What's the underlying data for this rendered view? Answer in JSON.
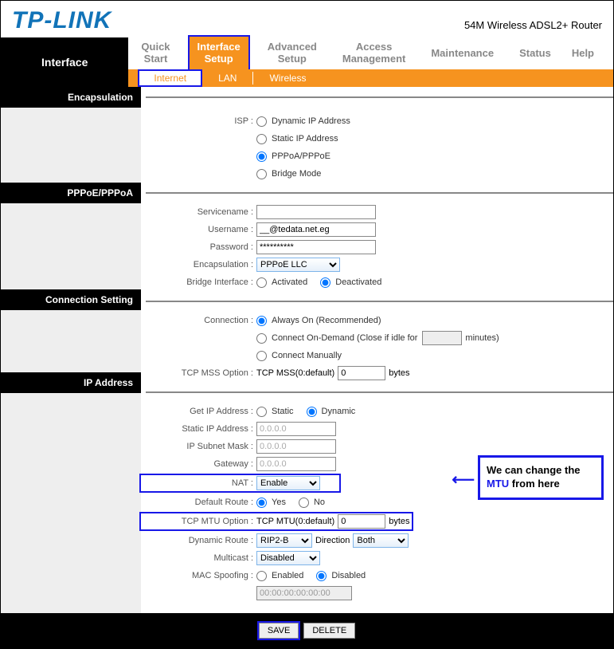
{
  "header": {
    "brand_a": "TP",
    "brand_b": "-LINK",
    "product": "54M Wireless ADSL2+ Router"
  },
  "nav": {
    "current": "Interface",
    "tabs": {
      "quick_start_l1": "Quick",
      "quick_start_l2": "Start",
      "interface_setup_l1": "Interface",
      "interface_setup_l2": "Setup",
      "advanced_setup_l1": "Advanced",
      "advanced_setup_l2": "Setup",
      "access_mgmt_l1": "Access",
      "access_mgmt_l2": "Management",
      "maintenance": "Maintenance",
      "status": "Status",
      "help": "Help"
    },
    "sub": {
      "internet": "Internet",
      "lan": "LAN",
      "wireless": "Wireless"
    }
  },
  "sections": {
    "encapsulation": "Encapsulation",
    "pppoe": "PPPoE/PPPoA",
    "conn": "Connection Setting",
    "ip": "IP Address"
  },
  "isp": {
    "label": "ISP :",
    "dyn": "Dynamic IP Address",
    "static": "Static IP Address",
    "pppoa": "PPPoA/PPPoE",
    "bridge": "Bridge Mode"
  },
  "ppp": {
    "servicename_label": "Servicename :",
    "servicename": "",
    "username_label": "Username :",
    "username": "__@tedata.net.eg",
    "password_label": "Password :",
    "password": "**********",
    "encap_label": "Encapsulation :",
    "encap_value": "PPPoE LLC",
    "bridge_if_label": "Bridge Interface :",
    "activated": "Activated",
    "deactivated": "Deactivated"
  },
  "conn": {
    "connection_label": "Connection :",
    "always_on": "Always On (Recommended)",
    "on_demand_a": "Connect On-Demand (Close if idle for",
    "on_demand_b": "minutes)",
    "manual": "Connect Manually",
    "mss_label": "TCP MSS Option :",
    "mss_text": "TCP MSS(0:default)",
    "mss_value": "0",
    "bytes": "bytes"
  },
  "ip": {
    "get_label": "Get IP Address :",
    "static": "Static",
    "dynamic": "Dynamic",
    "static_ip_label": "Static IP Address :",
    "static_ip": "0.0.0.0",
    "mask_label": "IP Subnet Mask :",
    "mask": "0.0.0.0",
    "gateway_label": "Gateway :",
    "gateway": "0.0.0.0",
    "nat_label": "NAT :",
    "nat": "Enable",
    "default_route_label": "Default Route :",
    "yes": "Yes",
    "no": "No",
    "mtu_label": "TCP MTU Option :",
    "mtu_text": "TCP MTU(0:default)",
    "mtu_value": "0",
    "mtu_bytes": "bytes",
    "dyn_route_label": "Dynamic Route :",
    "dyn_route": "RIP2-B",
    "direction": "Direction",
    "direction_val": "Both",
    "multicast_label": "Multicast :",
    "multicast": "Disabled",
    "mac_spoof_label": "MAC Spoofing :",
    "enabled": "Enabled",
    "disabled": "Disabled",
    "mac_val": "00:00:00:00:00:00"
  },
  "footer": {
    "save": "SAVE",
    "delete": "DELETE"
  },
  "annotation": {
    "line1": "We can change the",
    "mtu": "MTU",
    "line2": " from here"
  }
}
